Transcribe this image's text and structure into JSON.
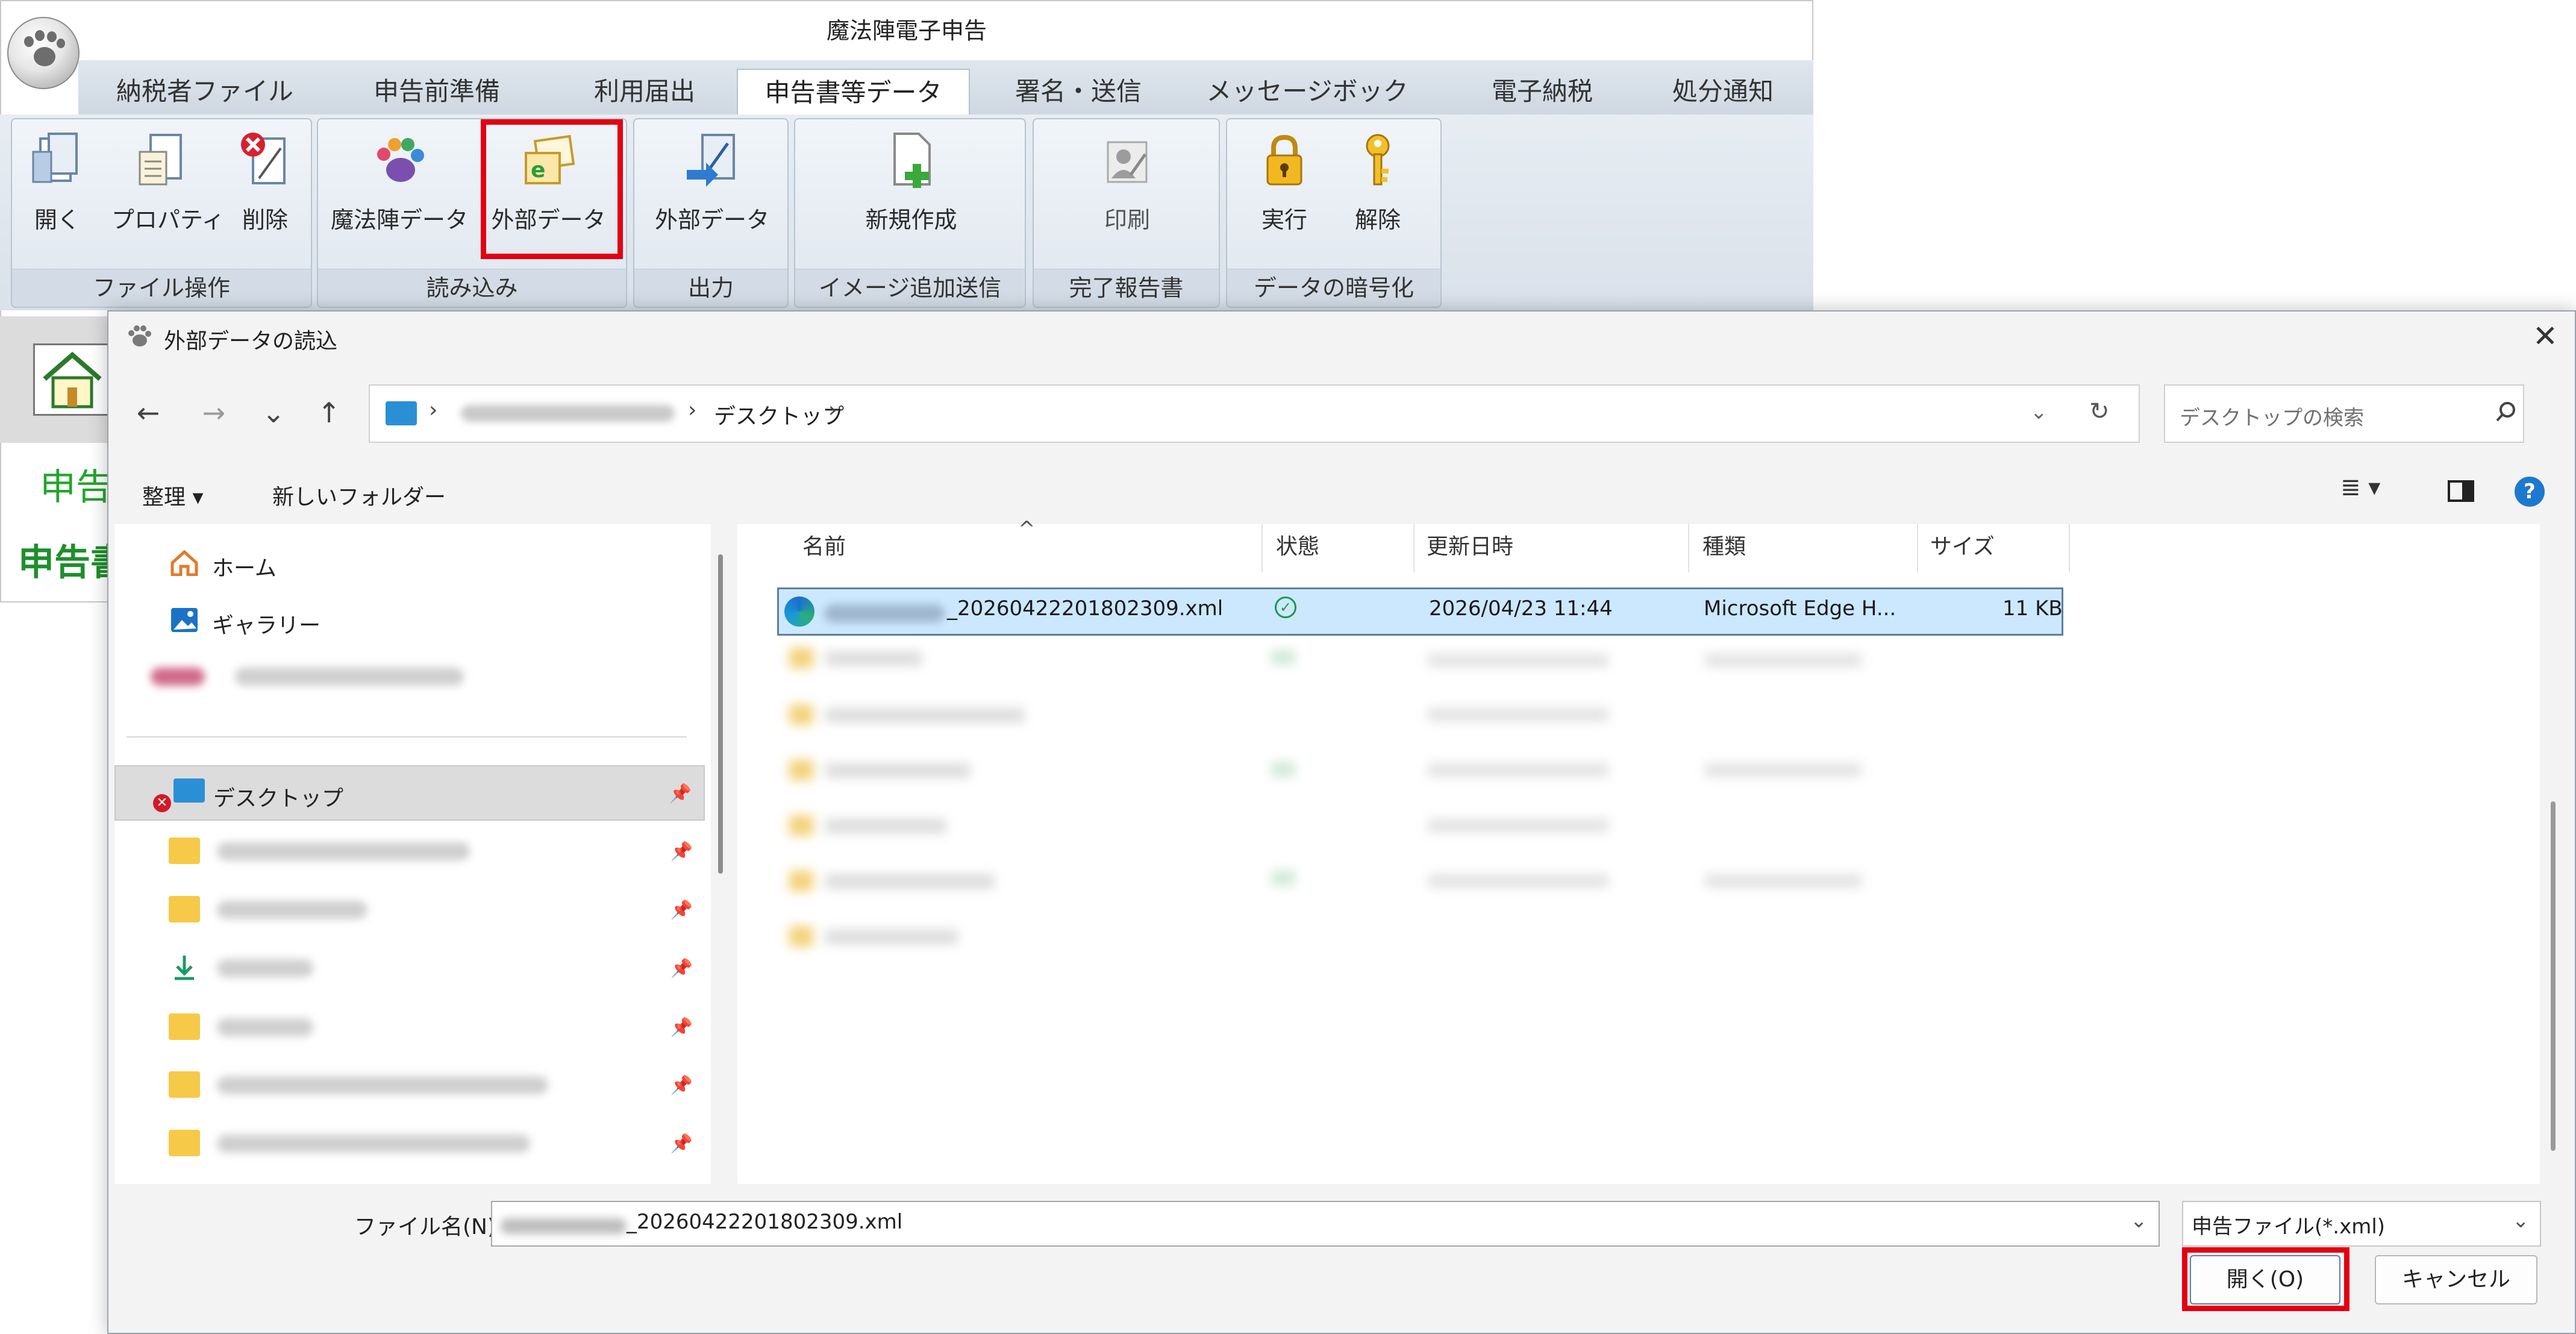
{
  "app": {
    "title": "魔法陣電子申告",
    "tabs": [
      "納税者ファイル",
      "申告前準備",
      "利用届出",
      "申告書等データ",
      "署名・送信",
      "メッセージボックス",
      "電子納税",
      "処分通知"
    ],
    "active_tab_index": 3,
    "groups": [
      {
        "label": "ファイル操作",
        "buttons": [
          "開く",
          "プロパティ",
          "削除"
        ]
      },
      {
        "label": "読み込み",
        "buttons": [
          "魔法陣データ",
          "外部データ"
        ]
      },
      {
        "label": "出力",
        "buttons": [
          "外部データ"
        ]
      },
      {
        "label": "イメージ追加送信",
        "buttons": [
          "新規作成"
        ]
      },
      {
        "label": "完了報告書",
        "buttons": [
          "印刷"
        ]
      },
      {
        "label": "データの暗号化",
        "buttons": [
          "実行",
          "解除"
        ]
      }
    ],
    "lower_text_1": "申告",
    "lower_text_2": "申告書",
    "highlight_color": "#e40012"
  },
  "dialog": {
    "title": "外部データの読込",
    "close": "✕",
    "nav": {
      "back": "←",
      "forward": "→",
      "recent": "⌄",
      "up": "↑"
    },
    "address": {
      "current": "デスクトップ",
      "separator": "›"
    },
    "search_placeholder": "デスクトップの検索",
    "toolbar": {
      "organize": "整理 ▾",
      "new_folder": "新しいフォルダー"
    },
    "nav_items": [
      {
        "label": "ホーム",
        "icon": "home-icon"
      },
      {
        "label": "ギャラリー",
        "icon": "gallery-icon"
      },
      {
        "label": "デスクトップ",
        "icon": "desktop-icon",
        "selected": true
      }
    ],
    "columns": [
      "名前",
      "状態",
      "更新日時",
      "種類",
      "サイズ"
    ],
    "selected_file": {
      "name": "_20260422201802309.xml",
      "status": "✓",
      "modified": "2026/04/23 11:44",
      "type": "Microsoft Edge H...",
      "size": "11 KB"
    },
    "filename_label": "ファイル名(N):",
    "filename_value": "_20260422201802309.xml",
    "filetype": "申告ファイル(*.xml)",
    "open_button": "開く(O)",
    "cancel_button": "キャンセル",
    "help": "?"
  }
}
